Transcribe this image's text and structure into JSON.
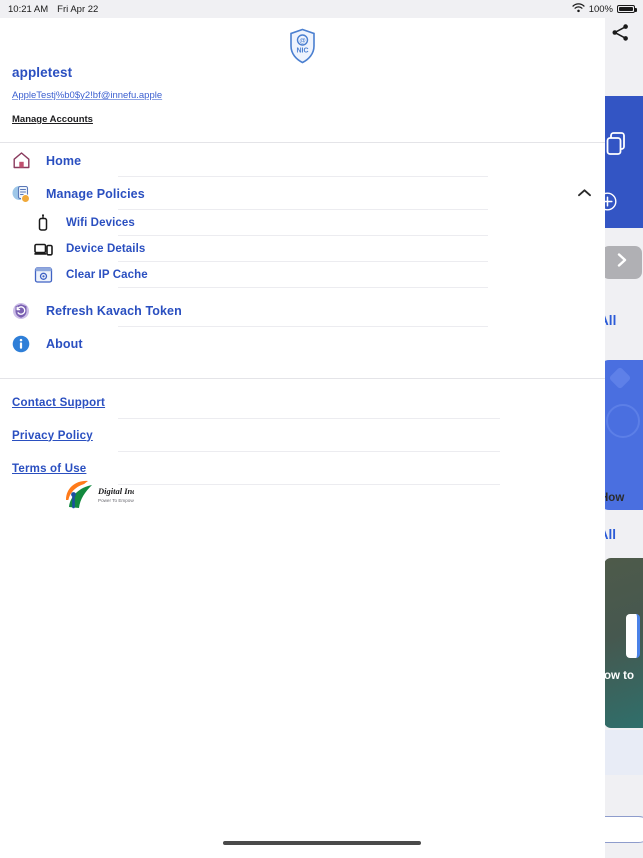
{
  "status_bar": {
    "time": "10:21 AM",
    "date": "Fri Apr 22",
    "wifi_icon": "wifi-icon",
    "battery_percent": "100%",
    "battery_icon": "battery-full-icon"
  },
  "drawer": {
    "share_icon": "share-icon",
    "brand_logo": "nic-shield-logo",
    "account": {
      "name": "appletest",
      "email": "AppleTestj%b0$y2!bf@innefu.apple",
      "manage_accounts_label": "Manage Accounts"
    },
    "nav_items": [
      {
        "label": "Home",
        "icon": "home-icon",
        "level": "top"
      },
      {
        "label": "Manage Policies",
        "icon": "manage-policies-icon",
        "level": "top",
        "expanded": true,
        "chevron_icon": "chevron-up-icon"
      },
      {
        "label": "Wifi Devices",
        "icon": "wifi-device-icon",
        "level": "sub"
      },
      {
        "label": "Device Details",
        "icon": "device-details-icon",
        "level": "sub"
      },
      {
        "label": "Clear IP Cache",
        "icon": "clear-ip-cache-icon",
        "level": "sub"
      },
      {
        "label": "Refresh Kavach Token",
        "icon": "refresh-kavach-token-icon",
        "level": "top"
      },
      {
        "label": "About",
        "icon": "about-info-icon",
        "level": "top"
      }
    ],
    "footer_links": [
      {
        "label": "Contact Support"
      },
      {
        "label": "Privacy Policy"
      },
      {
        "label": "Terms of Use"
      }
    ],
    "digital_india_logo": {
      "title": "Digital India",
      "tagline": "Power To Empower"
    }
  },
  "background_app": {
    "copy_icon": "copy-icon",
    "plus_icon": "plus-circle-icon",
    "chevron_right_icon": "chevron-right-icon",
    "see_all_label_1": "e All",
    "how_label": "How",
    "see_all_label_2": "e All",
    "video_caption": "ow to",
    "bottom_pill": ""
  },
  "colors": {
    "accent_blue": "#2a4fc0",
    "link_blue": "#3b5fd0",
    "card_blue": "#3355c4",
    "divider": "#ececf0",
    "text_dark": "#1d1d1f"
  }
}
